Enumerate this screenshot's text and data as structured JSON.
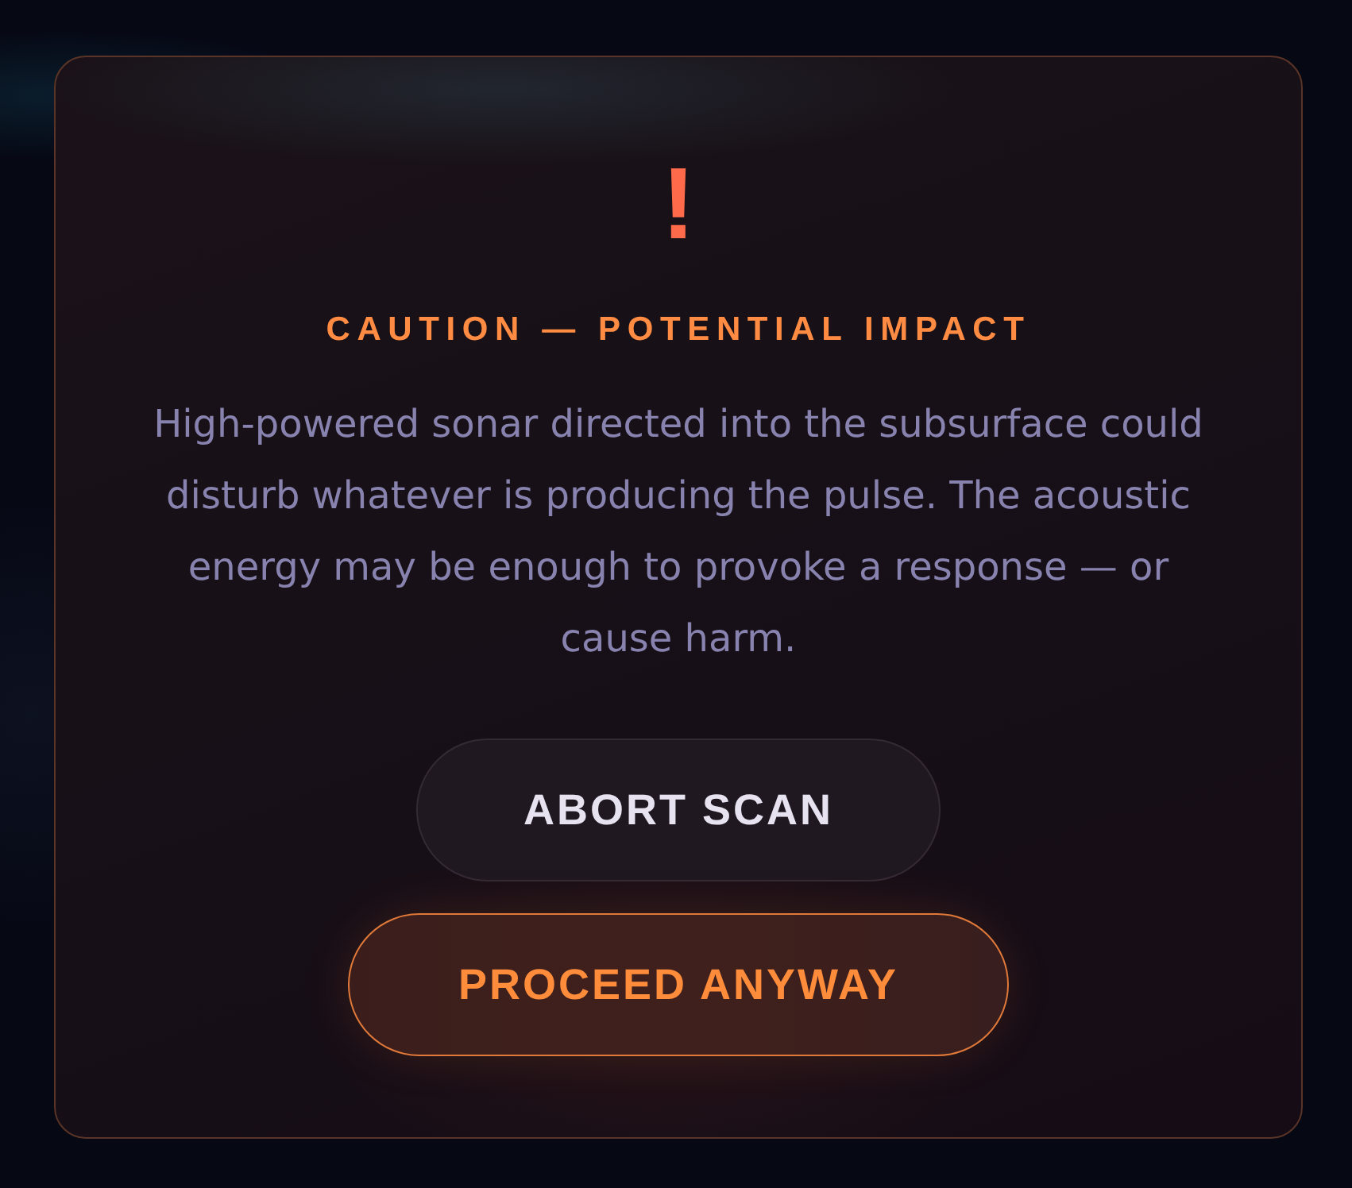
{
  "dialog": {
    "alert_glyph": "!",
    "title": "CAUTION — POTENTIAL IMPACT",
    "message": "High-powered sonar directed into the subsurface could disturb whatever is producing the pulse. The acoustic energy may be enough to provoke a response — or cause harm.",
    "buttons": [
      {
        "label": "ABORT SCAN",
        "kind": "secondary"
      },
      {
        "label": "PROCEED ANYWAY",
        "kind": "primary"
      }
    ]
  }
}
